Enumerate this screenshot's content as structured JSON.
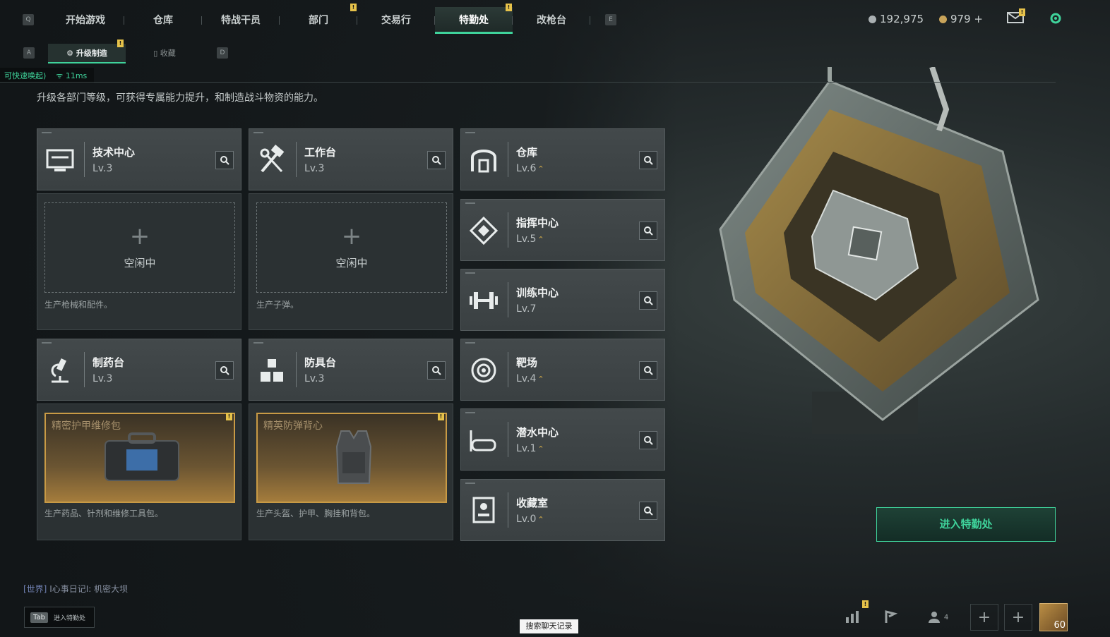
{
  "nav": {
    "left_key": "Q",
    "right_key": "E",
    "tabs": [
      {
        "label": "开始游戏"
      },
      {
        "label": "仓库"
      },
      {
        "label": "特战干员"
      },
      {
        "label": "部门"
      },
      {
        "label": "交易行"
      },
      {
        "label": "特勤处"
      },
      {
        "label": "改枪台"
      }
    ],
    "active_tab": "特勤处",
    "badge": "!"
  },
  "currency": {
    "primary": "192,975",
    "secondary": "979 +"
  },
  "subnav": {
    "left_key": "A",
    "right_key": "D",
    "tabs": [
      {
        "label": "升级制造"
      },
      {
        "label": "收藏"
      }
    ]
  },
  "status": {
    "text": "可快速唤起)",
    "ping": "11ms"
  },
  "description": "升级各部门等级，可获得专属能力提升，和制造战斗物资的能力。",
  "departments": {
    "tech": {
      "name": "技术中心",
      "level": "Lv.3",
      "icon": "monitor-icon"
    },
    "workbench": {
      "name": "工作台",
      "level": "Lv.3",
      "icon": "hammer-wrench-icon"
    },
    "pharmacy": {
      "name": "制药台",
      "level": "Lv.3",
      "icon": "microscope-icon"
    },
    "armor": {
      "name": "防具台",
      "level": "Lv.3",
      "icon": "boxes-icon"
    },
    "warehouse": {
      "name": "仓库",
      "level": "Lv.6",
      "icon": "warehouse-icon"
    },
    "command": {
      "name": "指挥中心",
      "level": "Lv.5",
      "icon": "diamond-target-icon"
    },
    "training": {
      "name": "训练中心",
      "level": "Lv.7",
      "icon": "dumbbell-icon"
    },
    "range": {
      "name": "靶场",
      "level": "Lv.4",
      "icon": "target-icon"
    },
    "diving": {
      "name": "潜水中心",
      "level": "Lv.1",
      "icon": "diving-mask-icon"
    },
    "collection": {
      "name": "收藏室",
      "level": "Lv.0",
      "icon": "display-case-icon"
    }
  },
  "production": {
    "tech": {
      "state": "空闲中",
      "desc": "生产枪械和配件。"
    },
    "workbench": {
      "state": "空闲中",
      "desc": "生产子弹。"
    },
    "pharmacy": {
      "item": "精密护甲维修包",
      "desc": "生产药品、针剂和维修工具包。"
    },
    "armor": {
      "item": "精英防弹背心",
      "desc": "生产头盔、护甲、胸挂和背包。"
    }
  },
  "enter_button": "进入特勤处",
  "chat": {
    "channel": "[世界]",
    "message": "I心事日记I: 机密大坝"
  },
  "tab_hint": {
    "key": "Tab",
    "label": "进入特勤处"
  },
  "search_chat": "搜索聊天记录",
  "friends_count": "4",
  "player_level": "60",
  "colors": {
    "accent": "#3fd39b",
    "badge": "#e6c24a",
    "gold_frame": "#c89a45"
  }
}
